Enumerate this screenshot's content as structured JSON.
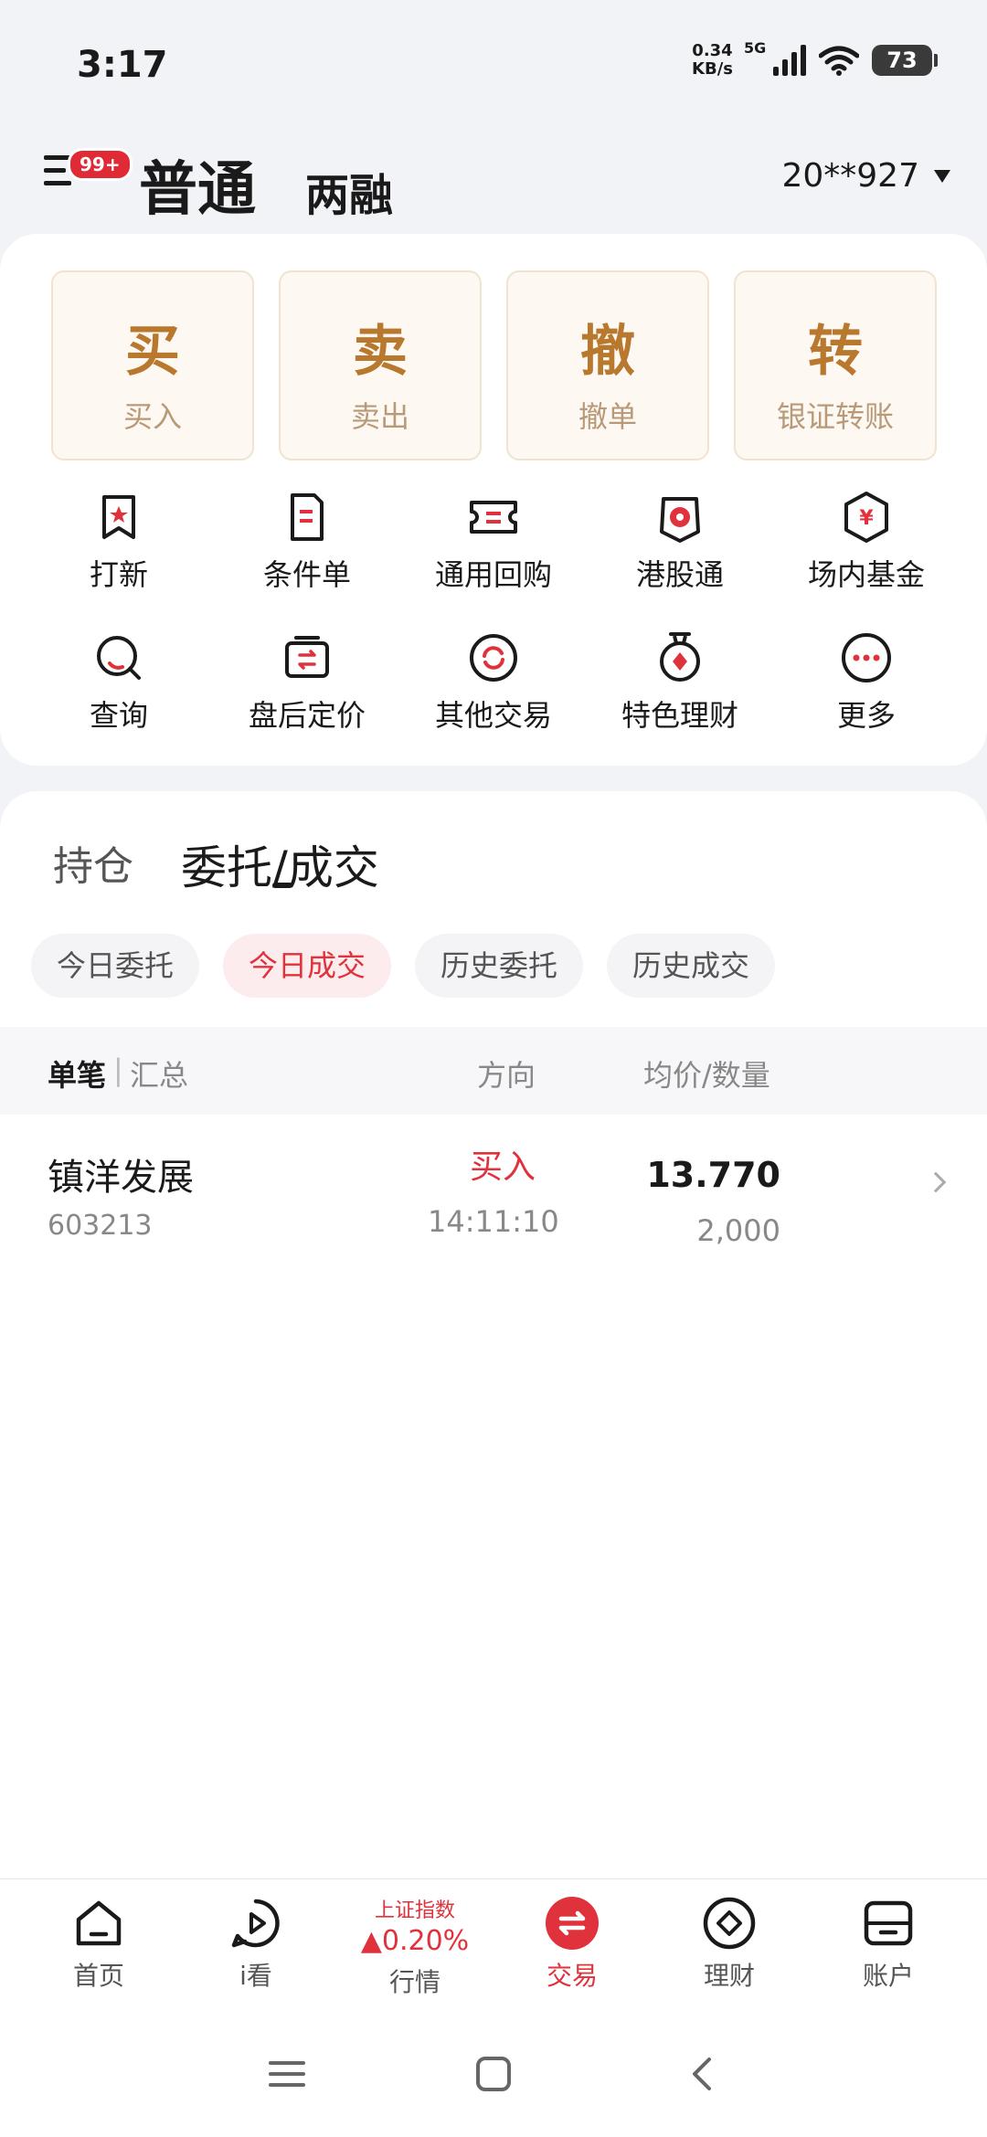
{
  "status_bar": {
    "time": "3:17",
    "net_speed": "0.34",
    "net_unit": "KB/s",
    "network": "5G",
    "battery": "73"
  },
  "header": {
    "badge": "99+",
    "tab_main": "普通",
    "tab_alt": "两融",
    "account": "20**927"
  },
  "actions": [
    {
      "big": "买",
      "small": "买入"
    },
    {
      "big": "卖",
      "small": "卖出"
    },
    {
      "big": "撤",
      "small": "撤单"
    },
    {
      "big": "转",
      "small": "银证转账"
    }
  ],
  "grid": [
    {
      "label": "打新",
      "icon": "star-bookmark-icon"
    },
    {
      "label": "条件单",
      "icon": "document-icon"
    },
    {
      "label": "通用回购",
      "icon": "ticket-icon"
    },
    {
      "label": "港股通",
      "icon": "hk-flower-icon"
    },
    {
      "label": "场内基金",
      "icon": "yen-hexagon-icon"
    },
    {
      "label": "查询",
      "icon": "search-icon"
    },
    {
      "label": "盘后定价",
      "icon": "exchange-box-icon"
    },
    {
      "label": "其他交易",
      "icon": "refresh-circle-icon"
    },
    {
      "label": "特色理财",
      "icon": "medal-icon"
    },
    {
      "label": "更多",
      "icon": "more-dots-icon"
    }
  ],
  "segments": {
    "hold": "持仓",
    "order": "委托/成交"
  },
  "chips": [
    "今日委托",
    "今日成交",
    "历史委托",
    "历史成交"
  ],
  "table": {
    "head": {
      "single": "单笔",
      "sep": "|",
      "summary": "汇总",
      "direction": "方向",
      "price_qty": "均价/数量"
    },
    "rows": [
      {
        "name": "镇洋发展",
        "code": "603213",
        "direction": "买入",
        "time": "14:11:10",
        "price": "13.770",
        "qty": "2,000"
      }
    ]
  },
  "bottom_nav": {
    "home": "首页",
    "ikan": "i看",
    "index_name": "上证指数",
    "index_value": "▲0.20%",
    "market": "行情",
    "trade": "交易",
    "finance": "理财",
    "account": "账户"
  },
  "colors": {
    "accent": "#e0323c",
    "gold": "#b8782e"
  }
}
